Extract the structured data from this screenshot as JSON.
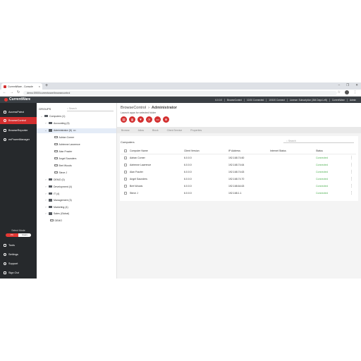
{
  "browser": {
    "tab_title": "CurrentWare - Console",
    "new_tab": "+",
    "url": "demo:5900/currentware/browsecontrol",
    "window_controls": [
      "–",
      "❐",
      "✕"
    ],
    "nav_buttons": [
      "←",
      "→",
      "↻"
    ]
  },
  "topbar": {
    "brand": "CurrentWare",
    "info": [
      "6.0.0.0",
      "BrowseControl",
      "10/10 Connected",
      "10/100 Connect",
      "License: Subscription (364 Days Left)",
      "CurrentWare",
      "Admin"
    ]
  },
  "leftnav": {
    "items": [
      {
        "label": "AccessPatrol",
        "icon": "shield-icon",
        "active": false
      },
      {
        "label": "BrowseControl",
        "icon": "globe-icon",
        "active": true
      },
      {
        "label": "BrowseReporter",
        "icon": "chart-icon",
        "active": false
      },
      {
        "label": "enPowerManager",
        "icon": "power-icon",
        "active": false
      }
    ],
    "select_mode_label": "Select Mode",
    "mode_pc": "PC",
    "mode_users": "Users",
    "bottom_items": [
      {
        "label": "Tools",
        "icon": "tools-icon"
      },
      {
        "label": "Settings",
        "icon": "gear-icon"
      },
      {
        "label": "Support",
        "icon": "help-icon"
      },
      {
        "label": "Sign Out",
        "icon": "signout-icon"
      }
    ]
  },
  "groups": {
    "title": "GROUPS",
    "search_placeholder": "Search",
    "tree": [
      {
        "label": "Computers (1)",
        "level": 0,
        "kind": "folder",
        "expanded": true
      },
      {
        "label": "Accounting (5)",
        "level": 1,
        "kind": "folder",
        "expanded": false
      },
      {
        "label": "Administrator (6)",
        "level": 1,
        "kind": "folder",
        "expanded": true,
        "selected": true,
        "menu": "•••"
      },
      {
        "label": "Adrian Corner",
        "level": 2,
        "kind": "pc"
      },
      {
        "label": "Adrienne Lawrence",
        "level": 2,
        "kind": "pc"
      },
      {
        "label": "Alan Frazier",
        "level": 2,
        "kind": "pc"
      },
      {
        "label": "Angel Saunders",
        "level": 2,
        "kind": "pc"
      },
      {
        "label": "Bret Woods",
        "level": 2,
        "kind": "pc"
      },
      {
        "label": "Steve J",
        "level": 2,
        "kind": "pc"
      },
      {
        "label": "DEMO (0)",
        "level": 1,
        "kind": "folder",
        "expanded": false
      },
      {
        "label": "Development (4)",
        "level": 1,
        "kind": "folder",
        "expanded": false
      },
      {
        "label": "IT (4)",
        "level": 1,
        "kind": "folder",
        "expanded": false
      },
      {
        "label": "Management (3)",
        "level": 1,
        "kind": "folder",
        "expanded": false
      },
      {
        "label": "Marketing (4)",
        "level": 1,
        "kind": "folder",
        "expanded": false
      },
      {
        "label": "Sales (Global)",
        "level": 1,
        "kind": "folder",
        "expanded": false
      },
      {
        "label": "DEMO",
        "level": 1,
        "kind": "pc"
      }
    ]
  },
  "main": {
    "breadcrumb_root": "BrowseControl",
    "breadcrumb_sep": "›",
    "breadcrumb_current": "Administrator",
    "launch_label": "Launch apps for selected folder",
    "app_buttons": [
      {
        "icon": "browse-icon",
        "glyph": "▤"
      },
      {
        "icon": "list-icon",
        "glyph": "≣"
      },
      {
        "icon": "filter-icon",
        "glyph": "▼"
      },
      {
        "icon": "clock-icon",
        "glyph": "◷"
      },
      {
        "icon": "screen-icon",
        "glyph": "▭"
      },
      {
        "icon": "block-icon",
        "glyph": "⊖"
      }
    ],
    "tabs": [
      "Browse",
      "Allow",
      "Block",
      "Client Service",
      "Properties"
    ],
    "section_title": "Computers",
    "search_placeholder": "Search",
    "columns": [
      "Computer Name",
      "Client Version",
      "IP Address",
      "Internet Status",
      "Status"
    ],
    "rows": [
      {
        "name": "Adrian Corner",
        "version": "6.0.0.0",
        "ip": "192.168.74.60",
        "internet": "",
        "status": "Connected"
      },
      {
        "name": "Adrienne Lawrence",
        "version": "6.0.0.0",
        "ip": "192.168.74.64",
        "internet": "",
        "status": "Connected"
      },
      {
        "name": "Alan Frazier",
        "version": "6.0.0.0",
        "ip": "192.168.74.63",
        "internet": "",
        "status": "Connected"
      },
      {
        "name": "Angel Saunders",
        "version": "6.0.0.0",
        "ip": "192.168.74.70",
        "internet": "",
        "status": "Connected"
      },
      {
        "name": "Bret Woods",
        "version": "6.0.0.0",
        "ip": "192.168.64.63",
        "internet": "",
        "status": "Connected"
      },
      {
        "name": "Steve J",
        "version": "6.0.0.0",
        "ip": "192.168.1.1",
        "internet": "",
        "status": "Connected"
      }
    ],
    "row_menu": "⋮"
  },
  "colors": {
    "accent": "#d32f2f",
    "nav_bg": "#26292c",
    "topbar_bg": "#3a3f44",
    "status_connected": "#4caf50"
  }
}
